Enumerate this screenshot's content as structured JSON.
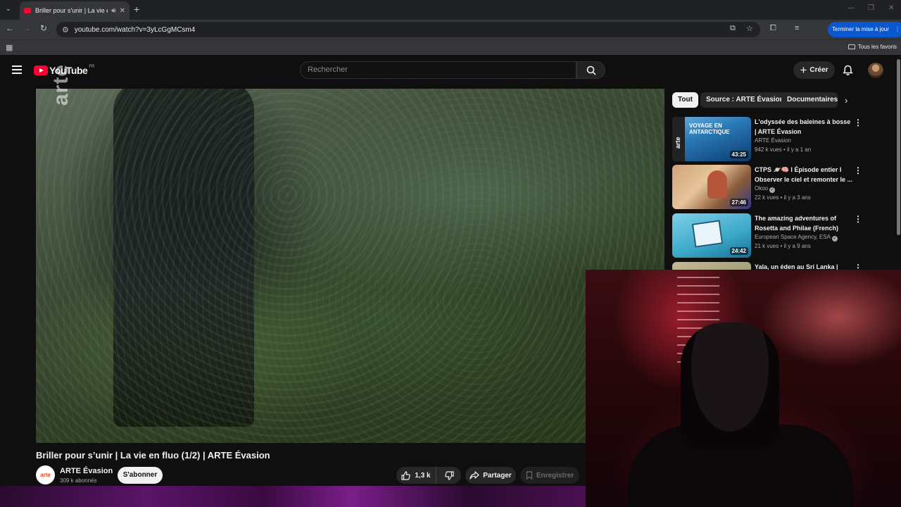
{
  "browser": {
    "tab_title": "Briller pour s'unir | La vie en",
    "url": "youtube.com/watch?v=3yLcGgMCsm4",
    "update_label": "Terminer la mise à jour",
    "bookmarks_label": "Tous les favoris"
  },
  "youtube": {
    "logo_text": "YouTube",
    "country_code": "FR",
    "search_placeholder": "Rechercher",
    "create_label": "Créer"
  },
  "video": {
    "watermark": "arte",
    "title": "Briller pour s’unir | La vie en fluo (1/2) | ARTE Évasion",
    "channel_name": "ARTE Évasion",
    "channel_logo_text": "arte",
    "subscribers": "309 k abonnés",
    "subscribe_label": "S'abonner",
    "likes": "1,3 k",
    "share_label": "Partager",
    "save_label": "Enregistrer"
  },
  "chips": [
    "Tout",
    "Source : ARTE Évasion",
    "Documentaires"
  ],
  "related": [
    {
      "title": "L'odyssée des baleines à bosse | ARTE Évasion",
      "channel": "ARTE Évasion",
      "meta": "942 k vues • il y a 1 an",
      "duration": "43:25",
      "thumb_text": "VOYAGE EN ANTARCTIQUE",
      "thumb_logo": "arte"
    },
    {
      "title": "CTPS 🪐🧠 I Épisode entier I Observer le ciel et remonter le ...",
      "channel": "Okoo",
      "meta": "22 k vues • il y a 3 ans",
      "duration": "27:46"
    },
    {
      "title": "The amazing adventures of Rosetta and Philae (French)",
      "channel": "European Space Agency, ESA",
      "meta": "21 k vues • il y a 9 ans",
      "duration": "24:42"
    },
    {
      "title": "Yala, un éden au Sri Lanka |",
      "channel": "",
      "meta": "",
      "duration": ""
    }
  ]
}
